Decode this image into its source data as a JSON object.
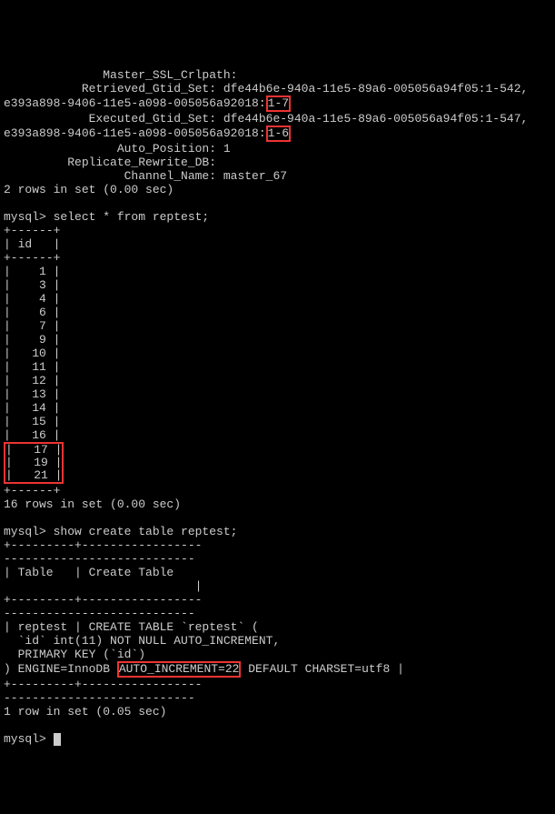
{
  "status_block": {
    "lines": [
      "              Master_SSL_Crlpath:",
      "           Retrieved_Gtid_Set: dfe44b6e-940a-11e5-89a6-005056a94f05:1-542,",
      "e393a898-9406-11e5-a098-005056a92018:1-7",
      "            Executed_Gtid_Set: dfe44b6e-940a-11e5-89a6-005056a94f05:1-547,",
      "e393a898-9406-11e5-a098-005056a92018:1-6",
      "                Auto_Position: 1",
      "         Replicate_Rewrite_DB:",
      "                 Channel_Name: master_67",
      "2 rows in set (0.00 sec)"
    ],
    "hl_range1": "1-7",
    "hl_range2": "1-6",
    "line1_prefix": "              Master_SSL_Crlpath:",
    "line2_prefix": "           Retrieved_Gtid_Set: dfe44b6e-940a-11e5-89a6-005056a94f05:1-542,",
    "line3_prefix": "e393a898-9406-11e5-a098-005056a92018:",
    "line4_prefix": "            Executed_Gtid_Set: dfe44b6e-940a-11e5-89a6-005056a94f05:1-547,",
    "line5_prefix": "e393a898-9406-11e5-a098-005056a92018:",
    "line6": "                Auto_Position: 1",
    "line7": "         Replicate_Rewrite_DB:",
    "line8": "                 Channel_Name: master_67",
    "line9": "2 rows in set (0.00 sec)"
  },
  "prompt1": "mysql> ",
  "query1": "select * from reptest;",
  "table1": {
    "sep": "+------+",
    "header": "| id   |",
    "rows_normal": [
      "|    1 |",
      "|    3 |",
      "|    4 |",
      "|    6 |",
      "|    7 |",
      "|    9 |",
      "|   10 |",
      "|   11 |",
      "|   12 |",
      "|   13 |",
      "|   14 |",
      "|   15 |",
      "|   16 |"
    ],
    "rows_hl": [
      "|   17 |",
      "|   19 |",
      "|   21 |"
    ],
    "footer": "16 rows in set (0.00 sec)"
  },
  "prompt2": "mysql> ",
  "query2": "show create table reptest;",
  "table2": {
    "sep_long": "+---------+-----------------",
    "dashes_line": "---------------------------",
    "header": "| Table   | Create Table     ",
    "blank_bar": "                           |",
    "row_l1": "| reptest | CREATE TABLE `reptest` (",
    "row_l2": "  `id` int(11) NOT NULL AUTO_INCREMENT,",
    "row_l3": "  PRIMARY KEY (`id`)",
    "row_l4_pre": ") ENGINE=InnoDB ",
    "row_l4_hl": "AUTO_INCREMENT=22",
    "row_l4_post": " DEFAULT CHARSET=utf8 |",
    "footer": "1 row in set (0.05 sec)"
  },
  "prompt3": "mysql> "
}
